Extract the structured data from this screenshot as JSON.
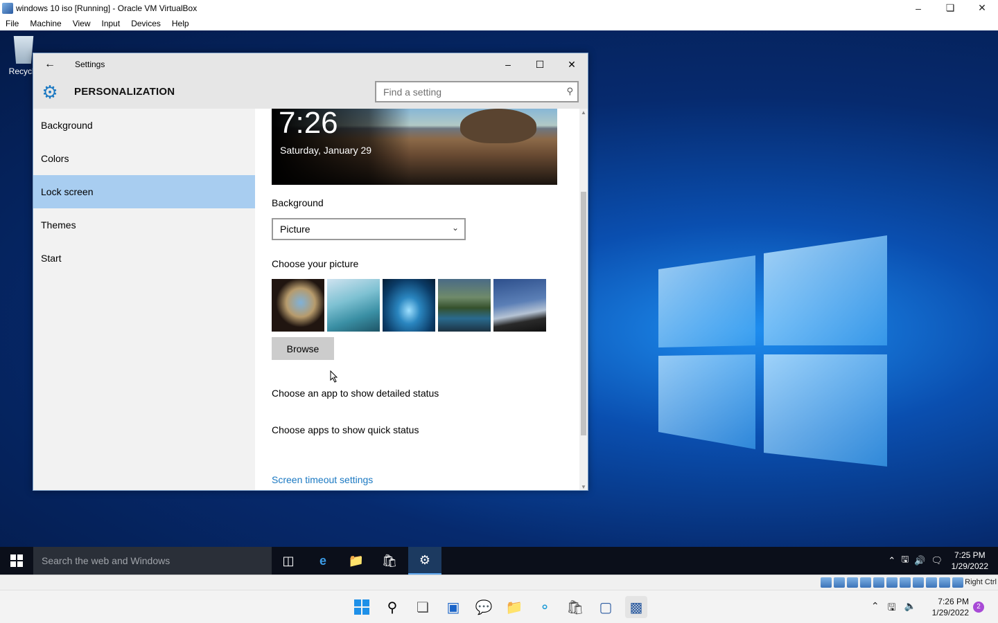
{
  "vbox": {
    "title": "windows 10 iso [Running] - Oracle VM VirtualBox",
    "menu": [
      "File",
      "Machine",
      "View",
      "Input",
      "Devices",
      "Help"
    ],
    "host_key": "Right Ctrl"
  },
  "desktop": {
    "recycle_label": "Recycle"
  },
  "settings": {
    "window_title": "Settings",
    "header_title": "PERSONALIZATION",
    "search_placeholder": "Find a setting",
    "nav": [
      {
        "label": "Background",
        "active": false
      },
      {
        "label": "Colors",
        "active": false
      },
      {
        "label": "Lock screen",
        "active": true
      },
      {
        "label": "Themes",
        "active": false
      },
      {
        "label": "Start",
        "active": false
      }
    ],
    "preview": {
      "time": "7:26",
      "date": "Saturday, January 29"
    },
    "background_label": "Background",
    "background_value": "Picture",
    "choose_picture_label": "Choose your picture",
    "browse_label": "Browse",
    "detailed_status_label": "Choose an app to show detailed status",
    "quick_status_label": "Choose apps to show quick status",
    "timeout_link": "Screen timeout settings"
  },
  "guest_taskbar": {
    "search_placeholder": "Search the web and Windows",
    "time": "7:25 PM",
    "date": "1/29/2022"
  },
  "host_taskbar": {
    "time": "7:26 PM",
    "date": "1/29/2022",
    "notification_count": "2"
  },
  "colors": {
    "accent": "#1a78c2",
    "nav_active": "#a8cdf0"
  }
}
